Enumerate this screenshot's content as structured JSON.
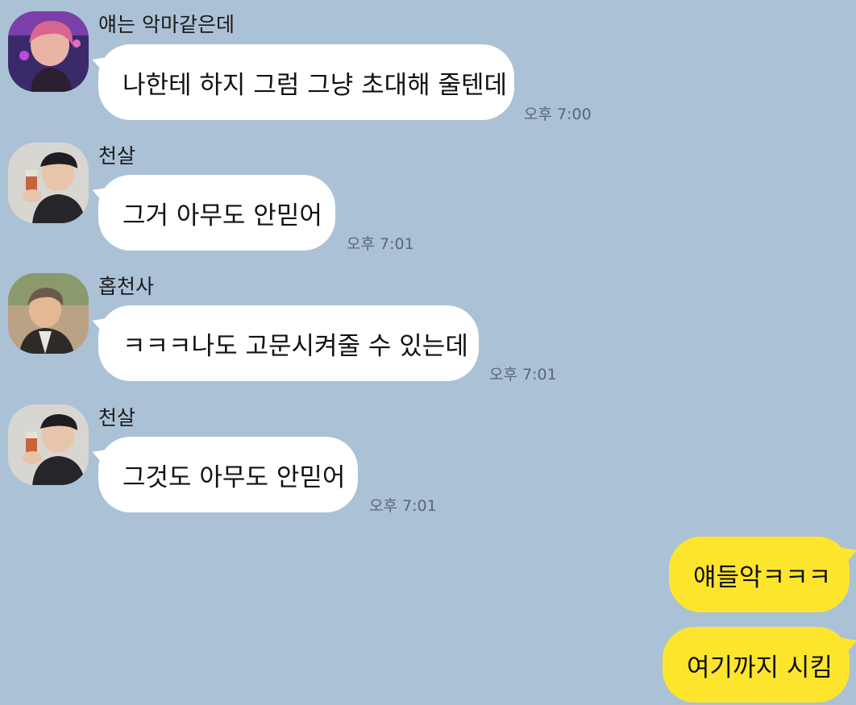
{
  "messages": [
    {
      "sender": "얘는 악마같은데",
      "text": "나한테 하지 그럼 그냥 초대해 줄텐데",
      "time": "오후 7:00",
      "avatar": "avatar-pink-hair"
    },
    {
      "sender": "천살",
      "text": "그거 아무도 안믿어",
      "time": "오후 7:01",
      "avatar": "avatar-cap-drinking"
    },
    {
      "sender": "홉천사",
      "text": "ㅋㅋㅋ나도 고문시켜줄 수 있는데",
      "time": "오후 7:01",
      "avatar": "avatar-outdoor-smile"
    },
    {
      "sender": "천살",
      "text": "그것도 아무도 안믿어",
      "time": "오후 7:01",
      "avatar": "avatar-cap-drinking"
    }
  ],
  "outgoing": [
    {
      "text": "얘들악ㅋㅋㅋ"
    },
    {
      "text": "여기까지 시킴"
    }
  ],
  "colors": {
    "background": "#abc1d6",
    "incoming_bubble": "#ffffff",
    "outgoing_bubble": "#fde52e",
    "timestamp": "#58677a"
  }
}
